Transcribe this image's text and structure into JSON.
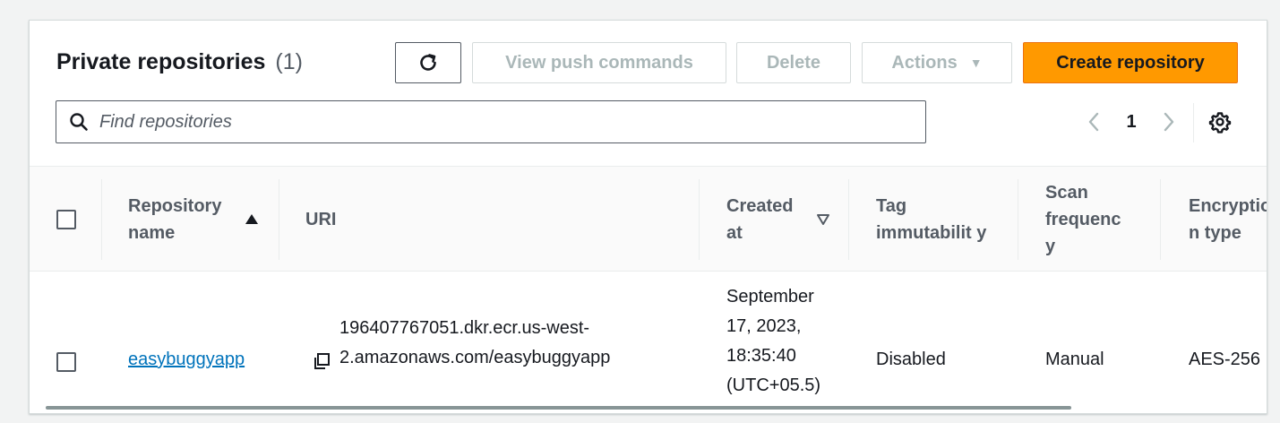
{
  "header": {
    "title": "Private repositories",
    "count": "(1)"
  },
  "toolbar": {
    "refresh_icon": "refresh-icon",
    "view_push_label": "View push commands",
    "delete_label": "Delete",
    "actions_label": "Actions",
    "create_label": "Create repository"
  },
  "search": {
    "placeholder": "Find repositories",
    "value": ""
  },
  "pagination": {
    "current_page": "1",
    "prev_icon": "chevron-left-icon",
    "next_icon": "chevron-right-icon",
    "settings_icon": "gear-icon"
  },
  "table": {
    "columns": [
      {
        "label": "Repository name",
        "sort": "ascending"
      },
      {
        "label": "URI"
      },
      {
        "label": "Created at",
        "sort": "descending-inactive"
      },
      {
        "label": "Tag immutabilit y"
      },
      {
        "label": "Scan frequenc y"
      },
      {
        "label": "Encryptio n type"
      }
    ],
    "rows": [
      {
        "repository_name": "easybuggyapp",
        "uri": "196407767051.dkr.ecr.us-west-2.amazonaws.com/easybuggyapp",
        "created_at": "September 17, 2023, 18:35:40 (UTC+05.5)",
        "tag_immutability": "Disabled",
        "scan_frequency": "Manual",
        "encryption_type": "AES-256"
      }
    ]
  },
  "colors": {
    "primary_button": "#ff9900",
    "link": "#0073bb",
    "disabled_text": "#aab7b8"
  }
}
